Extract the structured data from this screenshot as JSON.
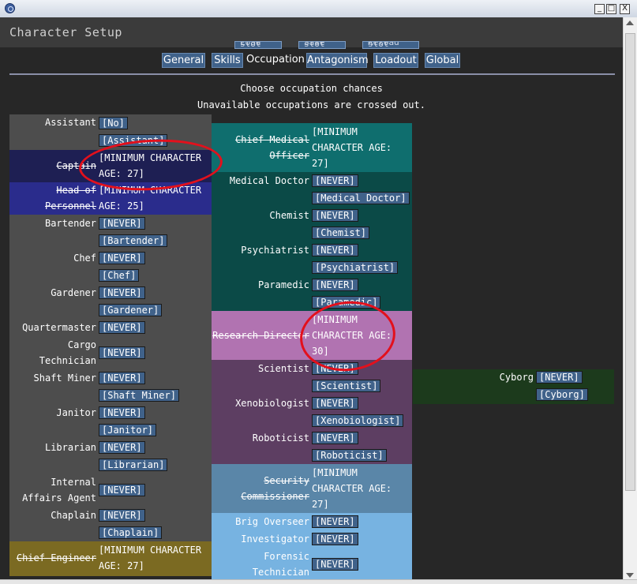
{
  "window": {
    "minimize": "_",
    "maximize": "□",
    "close": "X"
  },
  "header": {
    "title": "Character Setup"
  },
  "slots": {
    "label": "Slot",
    "buttons": [
      "Load slot",
      "Save slot",
      "Reload slot"
    ]
  },
  "tabs": [
    "General",
    "Skills",
    "Occupation",
    "Antagonism",
    "Loadout",
    "Global"
  ],
  "active_tab": "Occupation",
  "captions": {
    "line1": "Choose occupation chances",
    "line2": "Unavailable occupations are crossed out."
  },
  "colors": {
    "civilian": "#4d4d4d",
    "captain": "#1e1f53",
    "hop": "#2a2c8c",
    "engineering": "#7b6a22",
    "cmo": "#0f6e6e",
    "medical": "#0b4a47",
    "rd": "#b173b1",
    "science": "#5d3e62",
    "security_head": "#5a86a8",
    "security": "#77b3e1",
    "silicon": "#1c3a1c"
  },
  "left": {
    "assistant": {
      "label": "Assistant",
      "btn1": "[No]",
      "btn2": "[Assistant]"
    },
    "captain": {
      "label": "Captain",
      "note": "[MINIMUM CHARACTER AGE: 27]"
    },
    "hop": {
      "label": "Head of Personnel",
      "note": "[MINIMUM CHARACTER AGE: 25]"
    },
    "bartender": {
      "label": "Bartender",
      "btn1": "[NEVER]",
      "btn2": "[Bartender]"
    },
    "chef": {
      "label": "Chef",
      "btn1": "[NEVER]",
      "btn2": "[Chef]"
    },
    "gardener": {
      "label": "Gardener",
      "btn1": "[NEVER]",
      "btn2": "[Gardener]"
    },
    "quartermaster": {
      "label": "Quartermaster",
      "btn1": "[NEVER]"
    },
    "cargo": {
      "label": "Cargo Technician",
      "btn1": "[NEVER]"
    },
    "miner": {
      "label": "Shaft Miner",
      "btn1": "[NEVER]",
      "btn2": "[Shaft Miner]"
    },
    "janitor": {
      "label": "Janitor",
      "btn1": "[NEVER]",
      "btn2": "[Janitor]"
    },
    "librarian": {
      "label": "Librarian",
      "btn1": "[NEVER]",
      "btn2": "[Librarian]"
    },
    "iaa": {
      "label": "Internal Affairs Agent",
      "btn1": "[NEVER]"
    },
    "chaplain": {
      "label": "Chaplain",
      "btn1": "[NEVER]",
      "btn2": "[Chaplain]"
    },
    "ce": {
      "label": "Chief Engineer",
      "note": "[MINIMUM CHARACTER AGE: 27]"
    }
  },
  "mid": {
    "cmo": {
      "label": "Chief Medical Officer",
      "note": "[MINIMUM CHARACTER AGE: 27]"
    },
    "doctor": {
      "label": "Medical Doctor",
      "btn1": "[NEVER]",
      "btn2": "[Medical Doctor]"
    },
    "chemist": {
      "label": "Chemist",
      "btn1": "[NEVER]",
      "btn2": "[Chemist]"
    },
    "psych": {
      "label": "Psychiatrist",
      "btn1": "[NEVER]",
      "btn2": "[Psychiatrist]"
    },
    "paramedic": {
      "label": "Paramedic",
      "btn1": "[NEVER]",
      "btn2": "[Paramedic]"
    },
    "rd": {
      "label": "Research Director",
      "note": "[MINIMUM CHARACTER AGE: 30]"
    },
    "scientist": {
      "label": "Scientist",
      "btn1": "[NEVER]",
      "btn2": "[Scientist]"
    },
    "xeno": {
      "label": "Xenobiologist",
      "btn1": "[NEVER]",
      "btn2": "[Xenobiologist]"
    },
    "robo": {
      "label": "Roboticist",
      "btn1": "[NEVER]",
      "btn2": "[Roboticist]"
    },
    "hos": {
      "label": "Security Commissioner",
      "note": "[MINIMUM CHARACTER AGE: 27]"
    },
    "brig": {
      "label": "Brig Overseer",
      "btn1": "[NEVER]"
    },
    "investigator": {
      "label": "Investigator",
      "btn1": "[NEVER]"
    },
    "forensic": {
      "label": "Forensic Technician",
      "btn1": "[NEVER]"
    }
  },
  "right": {
    "cyborg": {
      "label": "Cyborg",
      "btn1": "[NEVER]",
      "btn2": "[Cyborg]"
    }
  }
}
